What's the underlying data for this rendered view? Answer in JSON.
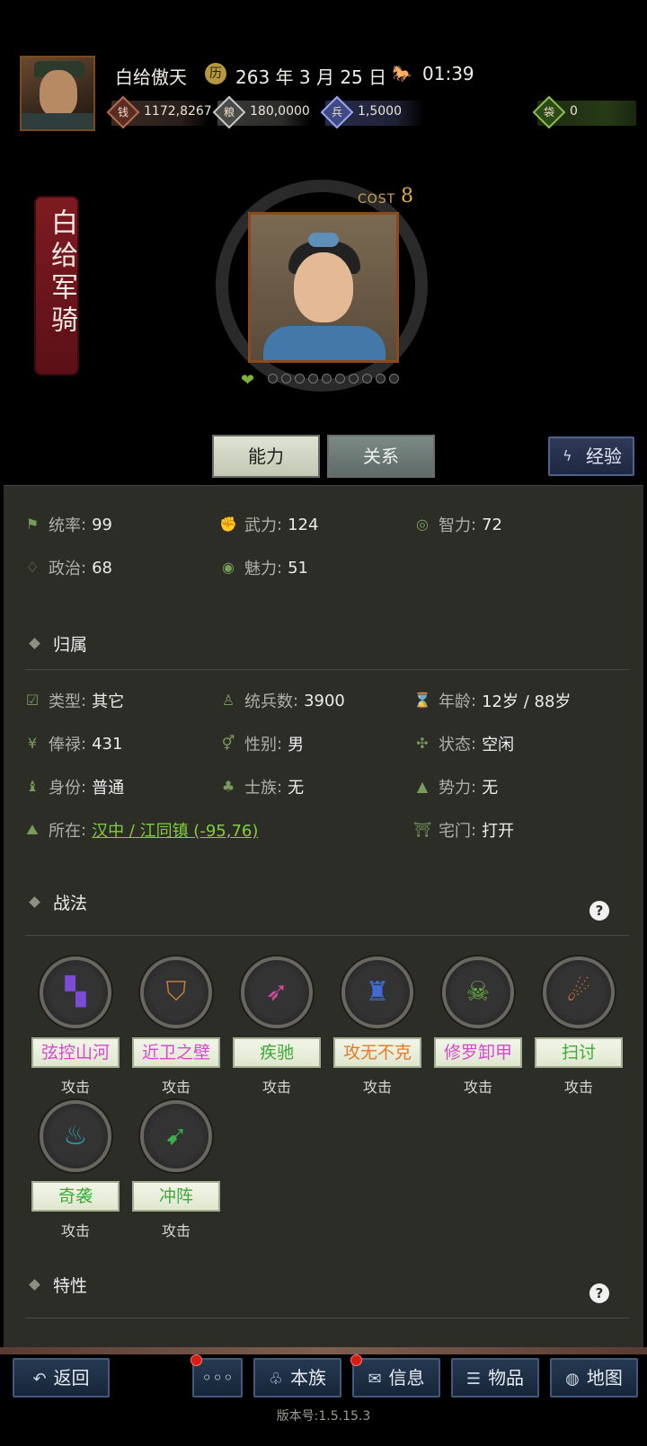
{
  "header": {
    "player_name": "白给傲天",
    "date": "263 年 3 月 25 日",
    "time": "01:39",
    "resources": [
      {
        "name": "coin-icon",
        "value": "1172,8267"
      },
      {
        "name": "grain-icon",
        "value": "180,0000"
      },
      {
        "name": "soldier-icon",
        "value": "1,5000"
      },
      {
        "name": "bag-icon",
        "value": "0"
      }
    ]
  },
  "character": {
    "title": "白给军骑",
    "cost_label": "COST",
    "cost_value": "8"
  },
  "tabs": {
    "ability": "能力",
    "relation": "关系",
    "experience": "经验"
  },
  "stats": {
    "command": {
      "label": "统率",
      "value": "99"
    },
    "force": {
      "label": "武力",
      "value": "124"
    },
    "intelligence": {
      "label": "智力",
      "value": "72"
    },
    "politics": {
      "label": "政治",
      "value": "68"
    },
    "charm": {
      "label": "魅力",
      "value": "51"
    }
  },
  "belonging": {
    "section_title": "归属",
    "type": {
      "label": "类型",
      "value": "其它"
    },
    "troops": {
      "label": "统兵数",
      "value": "3900"
    },
    "age": {
      "label": "年龄",
      "value": "12岁 / 88岁"
    },
    "salary": {
      "label": "俸禄",
      "value": "431"
    },
    "gender": {
      "label": "性别",
      "value": "男"
    },
    "status": {
      "label": "状态",
      "value": "空闲"
    },
    "identity": {
      "label": "身份",
      "value": "普通"
    },
    "clan": {
      "label": "士族",
      "value": "无"
    },
    "faction": {
      "label": "势力",
      "value": "无"
    },
    "location": {
      "label": "所在",
      "value": "汉中 / 江同镇 (-95,76)"
    },
    "house": {
      "label": "宅门",
      "value": "打开"
    }
  },
  "tactics": {
    "section_title": "战法",
    "help": "?",
    "skills": [
      {
        "name": "弦控山河",
        "type": "攻击",
        "color": "#d648d0"
      },
      {
        "name": "近卫之壁",
        "type": "攻击",
        "color": "#d648d0"
      },
      {
        "name": "疾驰",
        "type": "攻击",
        "color": "#3fa83a"
      },
      {
        "name": "攻无不克",
        "type": "攻击",
        "color": "#e77a28"
      },
      {
        "name": "修罗卸甲",
        "type": "攻击",
        "color": "#d648d0"
      },
      {
        "name": "扫讨",
        "type": "攻击",
        "color": "#3fa83a"
      },
      {
        "name": "奇袭",
        "type": "攻击",
        "color": "#3fa83a"
      },
      {
        "name": "冲阵",
        "type": "攻击",
        "color": "#3fa83a"
      }
    ]
  },
  "traits": {
    "section_title": "特性",
    "help": "?"
  },
  "bottom_nav": {
    "back": "返回",
    "more": "◦◦◦",
    "clan": "本族",
    "info": "信息",
    "items": "物品",
    "map": "地图",
    "version": "版本号:1.5.15.3"
  }
}
